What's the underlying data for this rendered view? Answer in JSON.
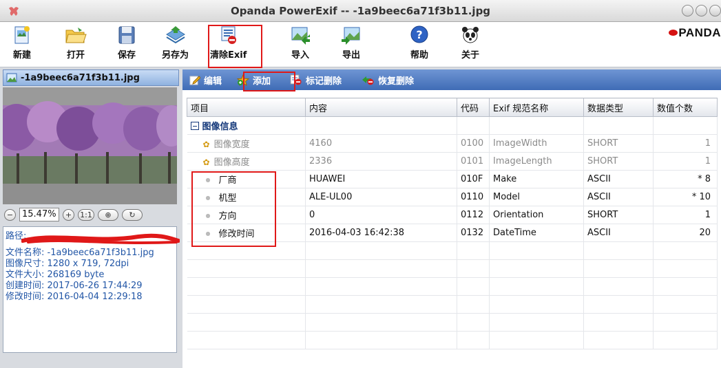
{
  "window": {
    "title": "Opanda PowerExif -- -1a9beec6a71f3b11.jpg"
  },
  "toolbar": {
    "new_label": "新建",
    "open_label": "打开",
    "save_label": "保存",
    "save_as_label": "另存为",
    "clear_exif_label": "清除Exif",
    "import_label": "导入",
    "export_label": "导出",
    "help_label": "帮助",
    "about_label": "关于"
  },
  "brand": {
    "logo_text": "PANDA"
  },
  "left_panel": {
    "file_header": "-1a9beec6a71f3b11.jpg",
    "zoom_value": "15.47%",
    "zoom_buttons": [
      "−",
      "+",
      "1:1",
      "⊕",
      "↻"
    ],
    "path_label": "路径:",
    "file_name": "文件名称: -1a9beec6a71f3b11.jpg",
    "dimensions": "图像尺寸: 1280 x 719, 72dpi",
    "file_size": "文件大小: 268169 byte",
    "created": "创建时间: 2017-06-26 17:44:29",
    "modified": "修改时间: 2016-04-04 12:29:18"
  },
  "actions": {
    "edit_label": "编辑",
    "add_label": "添加",
    "mark_delete_label": "标记删除",
    "restore_delete_label": "恢复删除"
  },
  "table": {
    "columns": [
      "项目",
      "内容",
      "代码",
      "Exif 规范名称",
      "数据类型",
      "数值个数"
    ],
    "group_label": "图像信息",
    "rows": [
      {
        "item": "图像宽度",
        "content": "4160",
        "code": "0100",
        "exif_name": "ImageWidth",
        "type": "SHORT",
        "count": "1"
      },
      {
        "item": "图像高度",
        "content": "2336",
        "code": "0101",
        "exif_name": "ImageLength",
        "type": "SHORT",
        "count": "1"
      },
      {
        "item": "厂商",
        "content": "HUAWEI",
        "code": "010F",
        "exif_name": "Make",
        "type": "ASCII",
        "count": "* 8"
      },
      {
        "item": "机型",
        "content": "ALE-UL00",
        "code": "0110",
        "exif_name": "Model",
        "type": "ASCII",
        "count": "* 10"
      },
      {
        "item": "方向",
        "content": "0",
        "code": "0112",
        "exif_name": "Orientation",
        "type": "SHORT",
        "count": "1"
      },
      {
        "item": "修改时间",
        "content": "2016-04-03 16:42:38",
        "code": "0132",
        "exif_name": "DateTime",
        "type": "ASCII",
        "count": "20"
      }
    ]
  },
  "colors": {
    "highlight": "#e01818",
    "action_bar": "#4f7cc4",
    "info_text": "#2256a6"
  }
}
